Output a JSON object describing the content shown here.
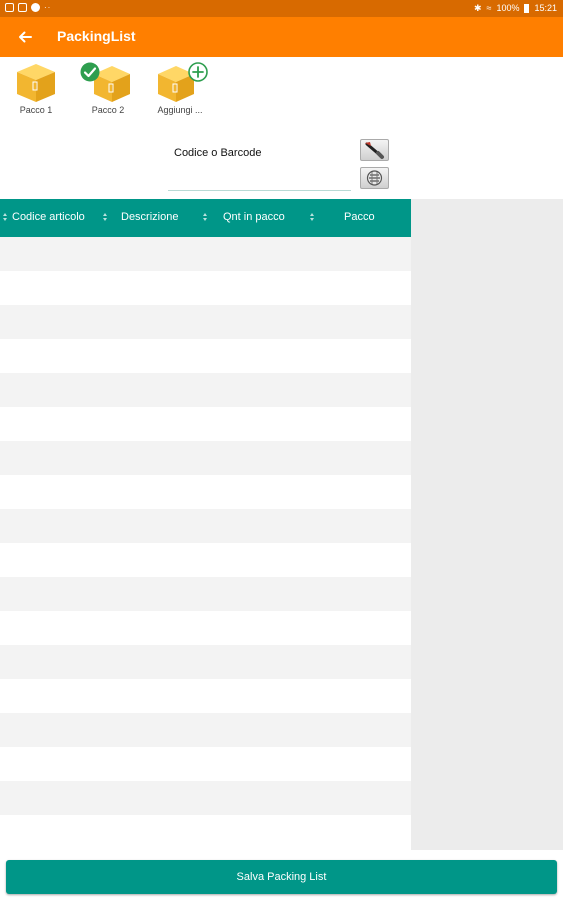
{
  "status_bar": {
    "battery": "100%",
    "time": "15:21",
    "icons": [
      "gallery-icon",
      "image-icon",
      "notification-icon",
      "more-dots-icon",
      "bluetooth-icon",
      "wifi-icon",
      "battery-icon"
    ]
  },
  "app_bar": {
    "title": "PackingList",
    "back_icon": "arrow-left-icon",
    "color": "#ff7f00"
  },
  "packages": [
    {
      "label": "Pacco 1",
      "icon": "box-icon",
      "badge": null
    },
    {
      "label": "Pacco 2",
      "icon": "box-icon",
      "badge": "check-icon"
    },
    {
      "label": "Aggiungi ...",
      "icon": "box-icon",
      "badge": "plus-icon"
    }
  ],
  "barcode": {
    "label": "Codice o Barcode",
    "value": "",
    "placeholder": "",
    "scanner_icon": "barcode-scanner-icon",
    "camera_icon": "camera-scan-icon"
  },
  "table": {
    "columns": [
      "Codice articolo",
      "Descrizione",
      "Qnt in pacco",
      "Pacco"
    ],
    "rows": [],
    "header_color": "#009688"
  },
  "footer": {
    "save_label": "Salva Packing List"
  }
}
